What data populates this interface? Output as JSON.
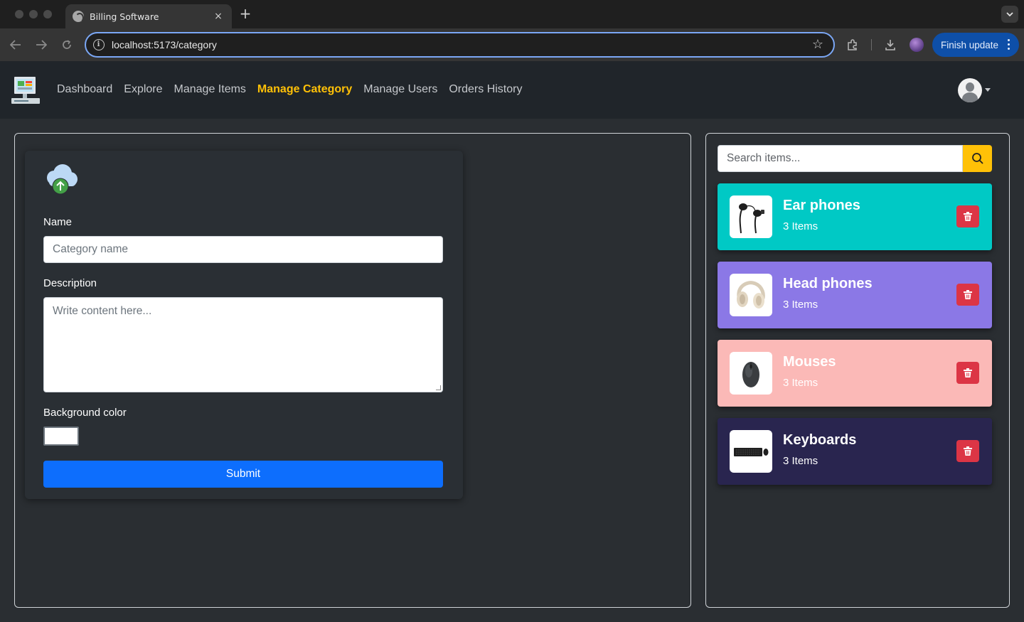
{
  "browser": {
    "tab_title": "Billing Software",
    "tab_close": "×",
    "new_tab": "+",
    "url": "localhost:5173/category",
    "finish_update": "Finish update"
  },
  "nav": {
    "items": [
      {
        "label": "Dashboard",
        "active": false
      },
      {
        "label": "Explore",
        "active": false
      },
      {
        "label": "Manage Items",
        "active": false
      },
      {
        "label": "Manage Category",
        "active": true
      },
      {
        "label": "Manage Users",
        "active": false
      },
      {
        "label": "Orders History",
        "active": false
      }
    ],
    "active_color": "#ffc107"
  },
  "form": {
    "name_label": "Name",
    "name_placeholder": "Category name",
    "description_label": "Description",
    "description_placeholder": "Write content here...",
    "bg_color_label": "Background color",
    "bg_color_value": "#ffffff",
    "submit_label": "Submit"
  },
  "search": {
    "placeholder": "Search items..."
  },
  "categories": [
    {
      "name": "Ear phones",
      "count": "3 Items",
      "color": "#00c9c5",
      "icon": "earphones-icon"
    },
    {
      "name": "Head phones",
      "count": "3 Items",
      "color": "#8b78e6",
      "icon": "headphones-icon"
    },
    {
      "name": "Mouses",
      "count": "3 Items",
      "color": "#fbb9b7",
      "icon": "mouse-icon"
    },
    {
      "name": "Keyboards",
      "count": "3 Items",
      "color": "#29254f",
      "icon": "keyboard-icon"
    }
  ],
  "colors": {
    "primary": "#0d6efd",
    "danger": "#dc3545",
    "warning": "#ffc107"
  }
}
